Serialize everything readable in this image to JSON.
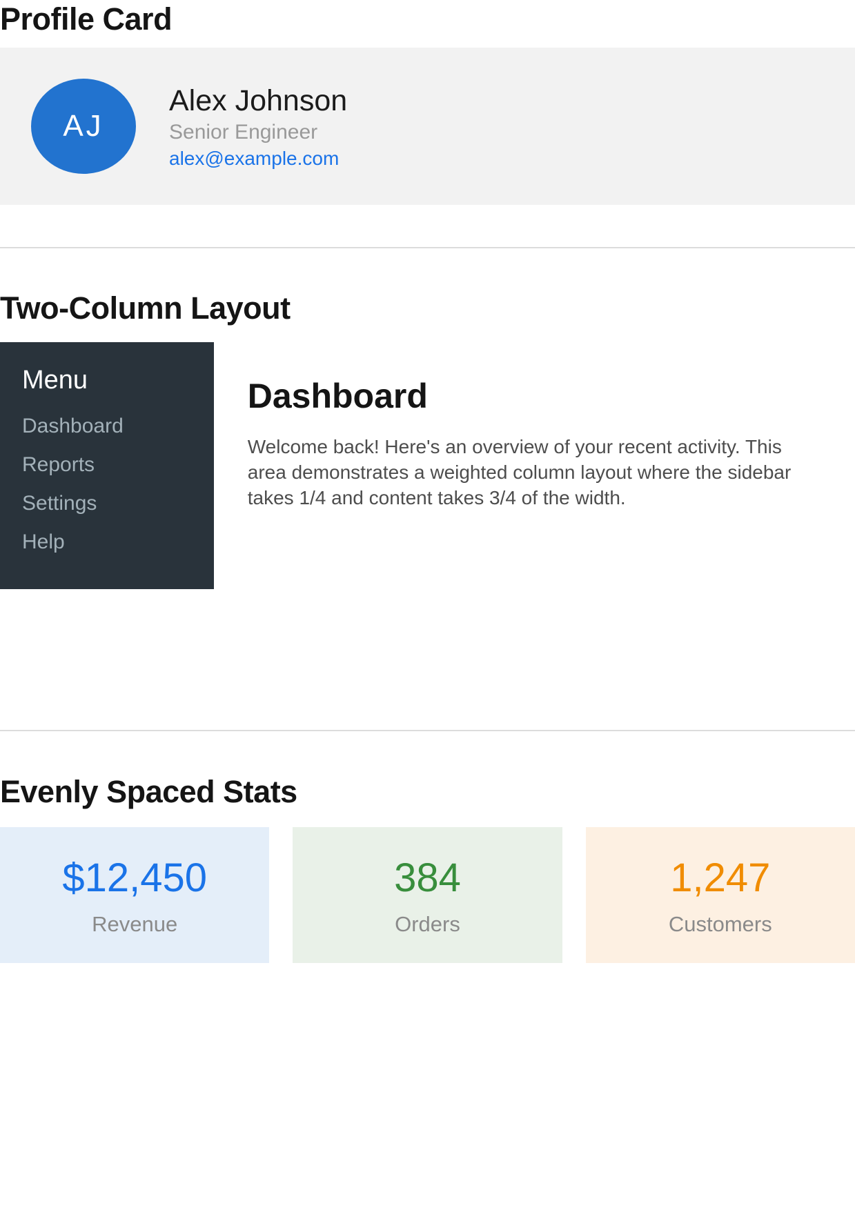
{
  "profile_section": {
    "heading": "Profile Card",
    "card": {
      "avatar_initials": "AJ",
      "name": "Alex Johnson",
      "job_title": "Senior Engineer",
      "email": "alex@example.com"
    }
  },
  "two_column_section": {
    "heading": "Two-Column Layout",
    "sidebar": {
      "title": "Menu",
      "items": [
        "Dashboard",
        "Reports",
        "Settings",
        "Help"
      ]
    },
    "content": {
      "title": "Dashboard",
      "body": "Welcome back! Here's an overview of your recent activity. This area demonstrates a weighted column layout where the sidebar takes 1/4 and content takes 3/4 of the width."
    }
  },
  "stats_section": {
    "heading": "Evenly Spaced Stats",
    "stats": [
      {
        "value": "$12,450",
        "label": "Revenue",
        "value_color": "#1a73e8",
        "bg_color": "#e4eef9"
      },
      {
        "value": "384",
        "label": "Orders",
        "value_color": "#388e3c",
        "bg_color": "#e9f1e8"
      },
      {
        "value": "1,247",
        "label": "Customers",
        "value_color": "#f08c00",
        "bg_color": "#fdf0e2"
      }
    ]
  },
  "colors": {
    "avatar_bg": "#2273cf",
    "avatar_text": "#ffffff",
    "email_link": "#1a73e8",
    "card_bg": "#f2f2f2",
    "sidebar_bg": "#29333b",
    "sidebar_title": "#ffffff",
    "sidebar_item": "#a3b1b9",
    "muted_text": "#999999",
    "body_text": "#4d4d4d",
    "stat_label": "#8a8a8a",
    "divider": "#dcdcdc"
  }
}
